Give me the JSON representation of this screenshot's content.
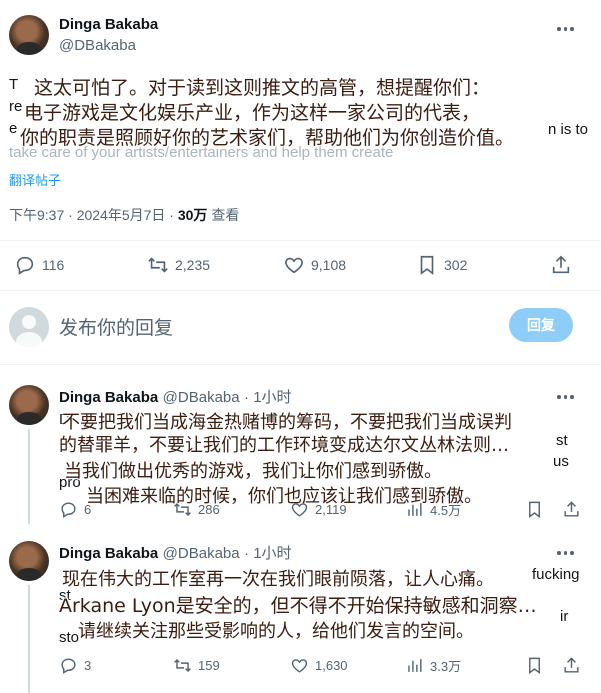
{
  "main_tweet": {
    "author_name": "Dinga Bakaba",
    "author_handle": "@DBakaba",
    "body_lines": [
      "T",
      "re",
      "e",
      "take care of your artists/entertainers and help them create"
    ],
    "body_tail": "n is to",
    "translate_label": "翻译帖子",
    "timestamp": "下午9:37 · 2024年5月7日 · ",
    "views_count": "30万",
    "views_label": " 查看",
    "subtitle_lines": [
      "这太可怕了。对于读到这则推文的高管，想提醒你们：",
      "电子游戏是文化娱乐产业，作为这样一家公司的代表，",
      "你的职责是照顾好你的艺术家们，帮助他们为你创造价值。"
    ],
    "replies": "116",
    "reposts": "2,235",
    "likes": "9,108",
    "bookmarks": "302"
  },
  "reply_box": {
    "placeholder": "发布你的回复",
    "button_label": "回复"
  },
  "reply1": {
    "author_name": "Dinga Bakaba",
    "author_handle": "@DBakaba",
    "time": "· 1小时",
    "body_fragments": [
      "D",
      "st",
      "us",
      "pro"
    ],
    "subtitle_lines": [
      "不要把我们当成海金热赌博的筹码，不要把我们当成误判",
      "的替罪羊，不要让我们的工作环境变成达尔文丛林法则…",
      "当我们做出优秀的游戏，我们让你们感到骄傲。",
      "当困难来临的时候，你们也应该让我们感到骄傲。"
    ],
    "replies": "6",
    "reposts": "286",
    "likes": "2,119",
    "views": "4.5万"
  },
  "reply2": {
    "author_name": "Dinga Bakaba",
    "author_handle": "@DBakaba",
    "time": "· 1小时",
    "body_fragments": [
      "fucking",
      "st",
      "ir",
      "sto"
    ],
    "subtitle_lines": [
      "现在伟大的工作室再一次在我们眼前陨落，让人心痛。",
      "Arkane Lyon是安全的，但不得不开始保持敏感和洞察…",
      "请继续关注那些受影响的人，给他们发言的空间。"
    ],
    "replies": "3",
    "reposts": "159",
    "likes": "1,630",
    "views": "3.3万"
  }
}
